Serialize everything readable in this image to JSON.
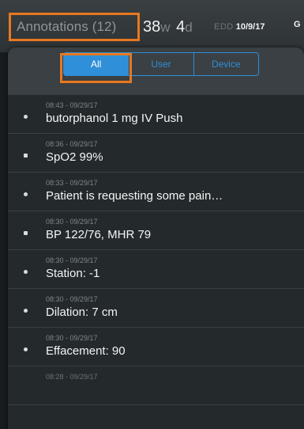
{
  "header": {
    "annotations_label": "Annotations (12)",
    "weeks_value": "38",
    "weeks_unit": "w",
    "days_value": "4",
    "days_unit": "d",
    "edd_label": "EDD",
    "edd_value": "10/9/17",
    "trailing_text": "G"
  },
  "filter": {
    "options": [
      "All",
      "User",
      "Device"
    ],
    "selected": "All"
  },
  "annotations": [
    {
      "time": "08:43 - 09/29/17",
      "text": "butorphanol 1 mg IV Push",
      "marker": "dot"
    },
    {
      "time": "08:36 - 09/29/17",
      "text": "SpO2  99%",
      "marker": "square"
    },
    {
      "time": "08:33 - 09/29/17",
      "text": "Patient is requesting some pain…",
      "marker": "dot"
    },
    {
      "time": "08:30 - 09/29/17",
      "text": "BP  122/76, MHR  79",
      "marker": "square"
    },
    {
      "time": "08:30 - 09/29/17",
      "text": "Station: -1",
      "marker": "dot"
    },
    {
      "time": "08:30 - 09/29/17",
      "text": "Dilation: 7 cm",
      "marker": "dot"
    },
    {
      "time": "08:30 - 09/29/17",
      "text": "Effacement: 90",
      "marker": "dot"
    },
    {
      "time": "08:28 - 09/29/17",
      "text": "",
      "marker": "dot"
    }
  ],
  "colors": {
    "accent_blue": "#2f8fd8",
    "highlight_orange": "#e8781f",
    "panel_bg": "#24292c"
  }
}
